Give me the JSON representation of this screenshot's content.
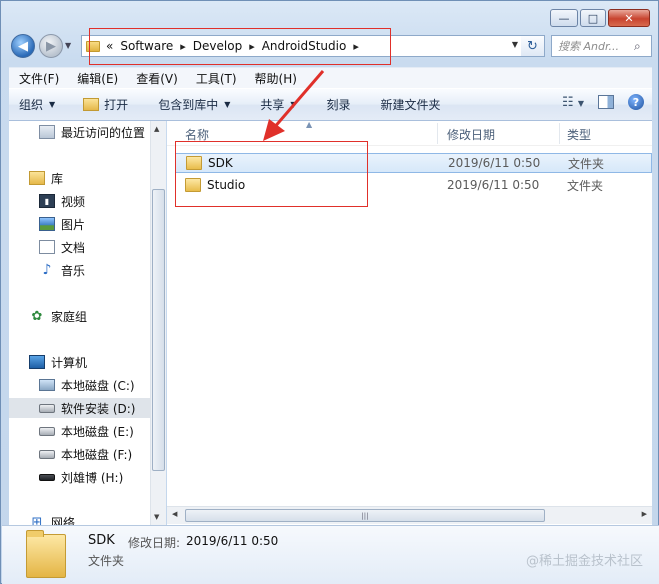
{
  "window": {
    "minimize_glyph": "—",
    "maximize_glyph": "□",
    "close_glyph": "✕"
  },
  "address": {
    "overflow": "«",
    "crumbs": [
      "Software",
      "Develop",
      "AndroidStudio"
    ],
    "separator": "▸",
    "dropdown": "▾"
  },
  "search": {
    "placeholder": "搜索 Andr...",
    "icon": "search-icon"
  },
  "menu": [
    "文件(F)",
    "编辑(E)",
    "查看(V)",
    "工具(T)",
    "帮助(H)"
  ],
  "toolbar": {
    "organize": "组织",
    "open": "打开",
    "include_in_library": "包含到库中",
    "share": "共享",
    "burn": "刻录",
    "new_folder": "新建文件夹"
  },
  "nav": {
    "recent": "最近访问的位置",
    "libraries": "库",
    "videos": "视频",
    "pictures": "图片",
    "documents": "文档",
    "music": "音乐",
    "homegroup": "家庭组",
    "computer": "计算机",
    "drive_c": "本地磁盘 (C:)",
    "drive_d": "软件安装 (D:)",
    "drive_e": "本地磁盘 (E:)",
    "drive_f": "本地磁盘 (F:)",
    "drive_h": "刘雄博 (H:)",
    "network": "网络"
  },
  "columns": {
    "name": "名称",
    "modified": "修改日期",
    "type": "类型"
  },
  "files": [
    {
      "name": "SDK",
      "modified": "2019/6/11 0:50",
      "type": "文件夹",
      "selected": true
    },
    {
      "name": "Studio",
      "modified": "2019/6/11 0:50",
      "type": "文件夹",
      "selected": false
    }
  ],
  "details": {
    "name": "SDK",
    "modified_label": "修改日期:",
    "modified_value": "2019/6/11 0:50",
    "type": "文件夹"
  },
  "watermark": "@稀土掘金技术社区",
  "colors": {
    "annotation_red": "#e0302a",
    "selection_blue": "#d6e8fa"
  }
}
